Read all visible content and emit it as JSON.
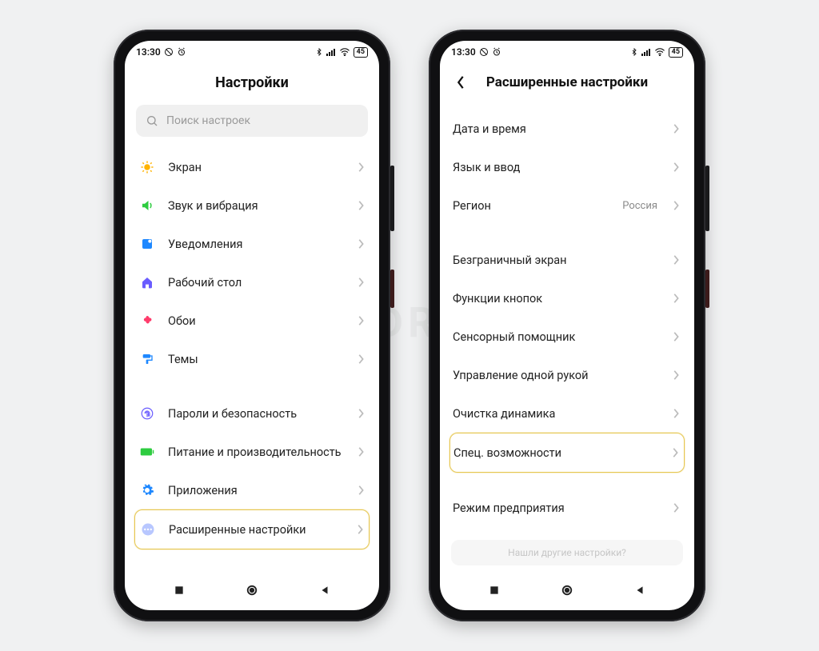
{
  "watermark": "SIBDROID",
  "status": {
    "time": "13:30",
    "battery": "45"
  },
  "phone1": {
    "header_title": "Настройки",
    "search_placeholder": "Поиск настроек",
    "group1": [
      {
        "icon": "sun",
        "label": "Экран"
      },
      {
        "icon": "sound",
        "label": "Звук и вибрация"
      },
      {
        "icon": "notif",
        "label": "Уведомления"
      },
      {
        "icon": "home",
        "label": "Рабочий стол"
      },
      {
        "icon": "wall",
        "label": "Обои"
      },
      {
        "icon": "theme",
        "label": "Темы"
      }
    ],
    "group2": [
      {
        "icon": "lock",
        "label": "Пароли и безопасность"
      },
      {
        "icon": "power",
        "label": "Питание и производительность"
      },
      {
        "icon": "apps",
        "label": "Приложения"
      },
      {
        "icon": "more",
        "label": "Расширенные настройки",
        "highlight": true
      }
    ]
  },
  "phone2": {
    "header_title": "Расширенные настройки",
    "group1": [
      {
        "label": "Дата и время"
      },
      {
        "label": "Язык и ввод"
      },
      {
        "label": "Регион",
        "value": "Россия"
      }
    ],
    "group2": [
      {
        "label": "Безграничный экран"
      },
      {
        "label": "Функции кнопок"
      },
      {
        "label": "Сенсорный помощник"
      },
      {
        "label": "Управление одной рукой"
      },
      {
        "label": "Очистка динамика"
      },
      {
        "label": "Спец. возможности",
        "highlight": true
      }
    ],
    "group3": [
      {
        "label": "Режим предприятия"
      }
    ],
    "footer_hint": "Нашли другие настройки?"
  }
}
